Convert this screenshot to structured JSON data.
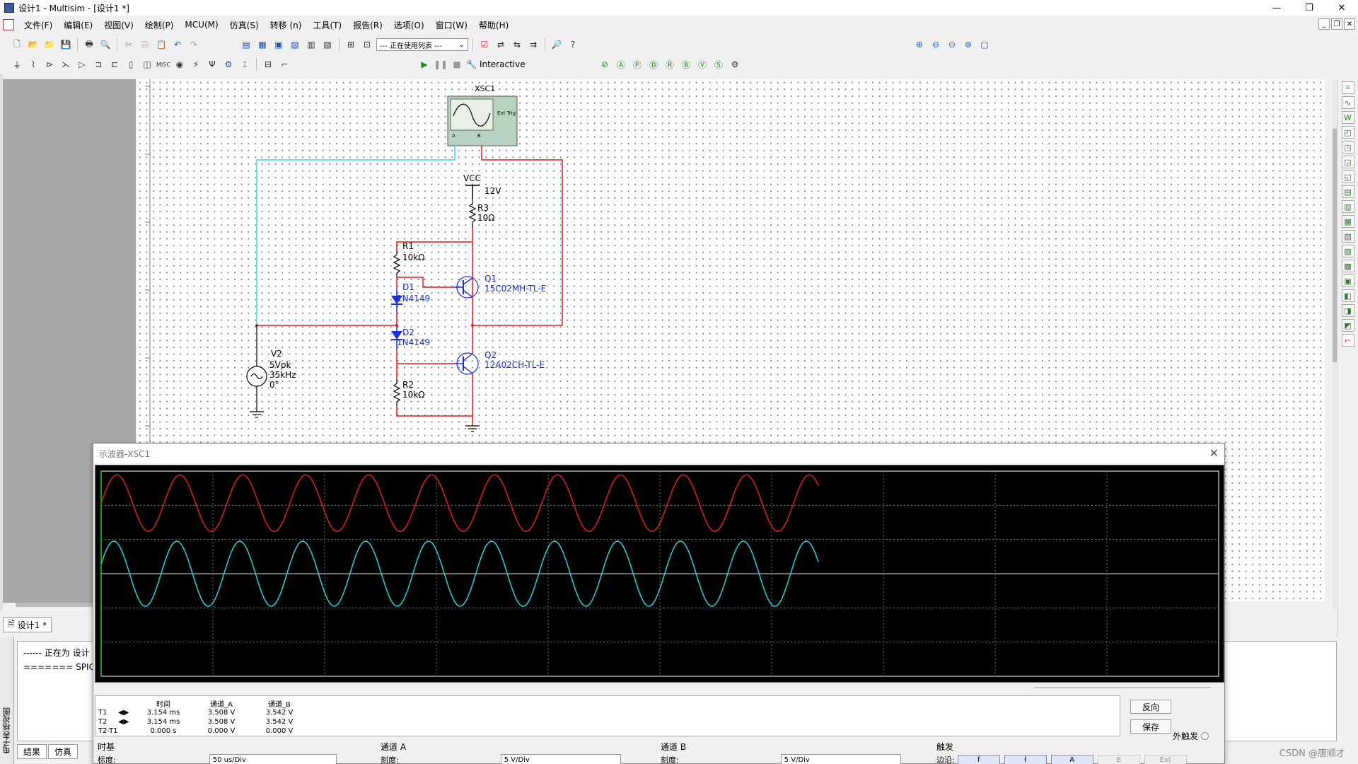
{
  "window": {
    "title": "设计1 - Multisim - [设计1 *]",
    "controls": [
      "—",
      "❐",
      "✕"
    ]
  },
  "menu": [
    "文件(F)",
    "编辑(E)",
    "视图(V)",
    "绘制(P)",
    "MCU(M)",
    "仿真(S)",
    "转移 (n)",
    "工具(T)",
    "报告(R)",
    "选项(O)",
    "窗口(W)",
    "帮助(H)"
  ],
  "toolbar": {
    "in_use_list": "--- 正在使用列表 ---",
    "sim_mode": "Interactive"
  },
  "schematic": {
    "labels": {
      "xsc1": "XSC1",
      "ext_trig": "Ext Trig",
      "a": "A",
      "b": "B",
      "vcc": "VCC",
      "vcc_val": "12V",
      "r3": "R3",
      "r3_val": "10Ω",
      "r1": "R1",
      "r1_val": "10kΩ",
      "d1": "D1",
      "d1_val": "1N4149",
      "q1": "Q1",
      "q1_val": "15C02MH-TL-E",
      "d2": "D2",
      "d2_val": "1N4149",
      "q2": "Q2",
      "q2_val": "12A02CH-TL-E",
      "v2": "V2",
      "v2_amp": "5Vpk",
      "v2_freq": "35kHz",
      "v2_phase": "0°",
      "r2": "R2",
      "r2_val": "10kΩ"
    },
    "colors": {
      "wire_red": "#e21c1c",
      "wire_cyan": "#3fd6e0",
      "part_blue": "#1d2fd6"
    }
  },
  "design_tab": "设计1 *",
  "spreadsheet": {
    "lines": [
      "------ 正在为 设计",
      "======= SPIC"
    ],
    "tabs": [
      "结果",
      "仿真"
    ],
    "vertical_label": "电子表格视图"
  },
  "scope": {
    "title": "示波器-XSC1",
    "readout": {
      "headers": [
        "时间",
        "通道_A",
        "通道_B"
      ],
      "rows": [
        {
          "label": "T1",
          "time": "3.154 ms",
          "a": "3.508 V",
          "b": "3.542 V"
        },
        {
          "label": "T2",
          "time": "3.154 ms",
          "a": "3.508 V",
          "b": "3.542 V"
        },
        {
          "label": "T2-T1",
          "time": "0.000 s",
          "a": "0.000 V",
          "b": "0.000 V"
        }
      ]
    },
    "buttons": {
      "reverse": "反向",
      "save": "保存",
      "ext_trigger": "外触发"
    },
    "timebase": {
      "title": "时基",
      "scale_label": "标度:",
      "scale": "50 us/Div"
    },
    "channel_a": {
      "title": "通道 A",
      "scale_label": "刻度:",
      "scale": "5  V/Div"
    },
    "channel_b": {
      "title": "通道 B",
      "scale_label": "刻度:",
      "scale": "5  V/Div"
    },
    "trigger": {
      "title": "触发",
      "edge_label": "边沿:",
      "buttons": [
        "f",
        "ł",
        "A",
        "B",
        "Ext"
      ]
    },
    "trace_colors": {
      "a": "#d42020",
      "b": "#2fc7cf",
      "grid": "#8a8a8a"
    }
  },
  "watermark": "CSDN @唐顺才"
}
